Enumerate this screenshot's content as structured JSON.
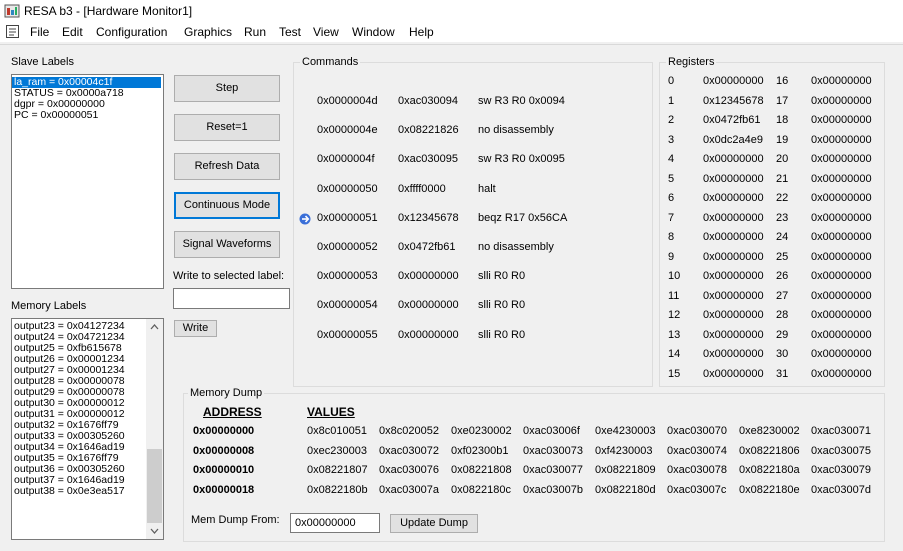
{
  "window": {
    "title": "RESA b3 - [Hardware Monitor1]"
  },
  "menu": [
    "File",
    "Edit",
    "Configuration",
    "Graphics",
    "Run",
    "Test",
    "View",
    "Window",
    "Help"
  ],
  "slave_labels": {
    "title": "Slave Labels",
    "items": [
      "la_ram = 0x00004c1f",
      "STATUS = 0x0000a718",
      "dgpr = 0x00000000",
      "PC = 0x00000051"
    ],
    "selected_index": 0
  },
  "buttons": {
    "step": "Step",
    "reset": "Reset=1",
    "refresh": "Refresh Data",
    "continuous": "Continuous Mode",
    "signal": "Signal Waveforms",
    "write": "Write"
  },
  "write_label": "Write to selected label:",
  "write_value": "",
  "memory_labels": {
    "title": "Memory Labels",
    "items": [
      "output23 = 0x04127234",
      "output24 = 0x04721234",
      "output25 = 0xfb615678",
      "output26 = 0x00001234",
      "output27 = 0x00001234",
      "output28 = 0x00000078",
      "output29 = 0x00000078",
      "output30 = 0x00000012",
      "output31 = 0x00000012",
      "output32 = 0x1676ff79",
      "output33 = 0x00305260",
      "output34 = 0x1646ad19",
      "output35 = 0x1676ff79",
      "output36 = 0x00305260",
      "output37 = 0x1646ad19",
      "output38 = 0x0e3ea517"
    ]
  },
  "commands": {
    "title": "Commands",
    "rows": [
      {
        "addr": "0x0000004d",
        "code": "0xac030094",
        "dis": "sw R3 R0 0x0094",
        "current": false
      },
      {
        "addr": "0x0000004e",
        "code": "0x08221826",
        "dis": "no disassembly",
        "current": false
      },
      {
        "addr": "0x0000004f",
        "code": "0xac030095",
        "dis": "sw R3 R0 0x0095",
        "current": false
      },
      {
        "addr": "0x00000050",
        "code": "0xffff0000",
        "dis": "halt",
        "current": false
      },
      {
        "addr": "0x00000051",
        "code": "0x12345678",
        "dis": "beqz R17 0x56CA",
        "current": true
      },
      {
        "addr": "0x00000052",
        "code": "0x0472fb61",
        "dis": "no disassembly",
        "current": false
      },
      {
        "addr": "0x00000053",
        "code": "0x00000000",
        "dis": "slli R0 R0",
        "current": false
      },
      {
        "addr": "0x00000054",
        "code": "0x00000000",
        "dis": "slli R0 R0",
        "current": false
      },
      {
        "addr": "0x00000055",
        "code": "0x00000000",
        "dis": "slli R0 R0",
        "current": false
      }
    ]
  },
  "registers": {
    "title": "Registers",
    "rows": [
      {
        "n1": "0",
        "v1": "0x00000000",
        "n2": "16",
        "v2": "0x00000000"
      },
      {
        "n1": "1",
        "v1": "0x12345678",
        "n2": "17",
        "v2": "0x00000000"
      },
      {
        "n1": "2",
        "v1": "0x0472fb61",
        "n2": "18",
        "v2": "0x00000000"
      },
      {
        "n1": "3",
        "v1": "0x0dc2a4e9",
        "n2": "19",
        "v2": "0x00000000"
      },
      {
        "n1": "4",
        "v1": "0x00000000",
        "n2": "20",
        "v2": "0x00000000"
      },
      {
        "n1": "5",
        "v1": "0x00000000",
        "n2": "21",
        "v2": "0x00000000"
      },
      {
        "n1": "6",
        "v1": "0x00000000",
        "n2": "22",
        "v2": "0x00000000"
      },
      {
        "n1": "7",
        "v1": "0x00000000",
        "n2": "23",
        "v2": "0x00000000"
      },
      {
        "n1": "8",
        "v1": "0x00000000",
        "n2": "24",
        "v2": "0x00000000"
      },
      {
        "n1": "9",
        "v1": "0x00000000",
        "n2": "25",
        "v2": "0x00000000"
      },
      {
        "n1": "10",
        "v1": "0x00000000",
        "n2": "26",
        "v2": "0x00000000"
      },
      {
        "n1": "11",
        "v1": "0x00000000",
        "n2": "27",
        "v2": "0x00000000"
      },
      {
        "n1": "12",
        "v1": "0x00000000",
        "n2": "28",
        "v2": "0x00000000"
      },
      {
        "n1": "13",
        "v1": "0x00000000",
        "n2": "29",
        "v2": "0x00000000"
      },
      {
        "n1": "14",
        "v1": "0x00000000",
        "n2": "30",
        "v2": "0x00000000"
      },
      {
        "n1": "15",
        "v1": "0x00000000",
        "n2": "31",
        "v2": "0x00000000"
      }
    ]
  },
  "memory_dump": {
    "title": "Memory Dump",
    "address_header": "ADDRESS",
    "values_header": "VALUES",
    "rows": [
      {
        "addr": "0x00000000",
        "values": [
          "0x8c010051",
          "0x8c020052",
          "0xe0230002",
          "0xac03006f",
          "0xe4230003",
          "0xac030070",
          "0xe8230002",
          "0xac030071"
        ]
      },
      {
        "addr": "0x00000008",
        "values": [
          "0xec230003",
          "0xac030072",
          "0xf02300b1",
          "0xac030073",
          "0xf4230003",
          "0xac030074",
          "0x08221806",
          "0xac030075"
        ]
      },
      {
        "addr": "0x00000010",
        "values": [
          "0x08221807",
          "0xac030076",
          "0x08221808",
          "0xac030077",
          "0x08221809",
          "0xac030078",
          "0x0822180a",
          "0xac030079"
        ]
      },
      {
        "addr": "0x00000018",
        "values": [
          "0x0822180b",
          "0xac03007a",
          "0x0822180c",
          "0xac03007b",
          "0x0822180d",
          "0xac03007c",
          "0x0822180e",
          "0xac03007d"
        ]
      }
    ],
    "from_label": "Mem Dump From:",
    "from_value": "0x00000000",
    "update_button": "Update Dump"
  }
}
